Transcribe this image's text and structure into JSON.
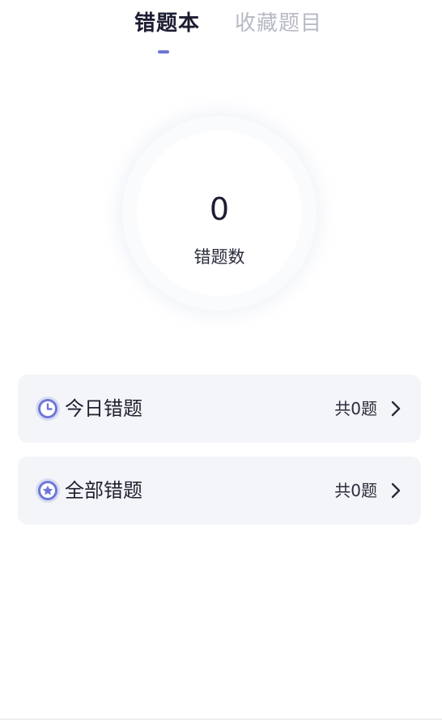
{
  "tabs": [
    {
      "label": "错题本",
      "active": true
    },
    {
      "label": "收藏题目",
      "active": false
    }
  ],
  "summary": {
    "count": "0",
    "label": "错题数"
  },
  "lists": [
    {
      "title": "今日错题",
      "count_text": "共0题",
      "icon": "clock-icon"
    },
    {
      "title": "全部错题",
      "count_text": "共0题",
      "icon": "star-icon"
    }
  ],
  "colors": {
    "accent": "#6d78d6",
    "card_background": "#f4f5f8",
    "inactive_tab": "#b7b9c4"
  }
}
